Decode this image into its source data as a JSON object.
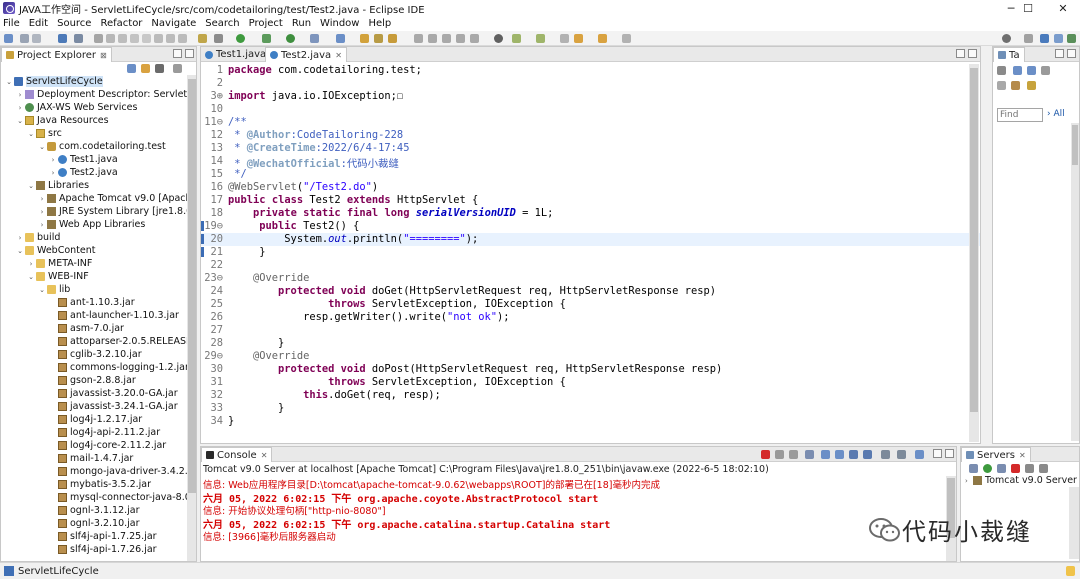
{
  "window": {
    "title": "JAVA工作空间 - ServletLifeCycle/src/com/codetailoring/test/Test2.java - Eclipse IDE",
    "min_glyph": "─",
    "max_glyph": "☐",
    "close_glyph": "✕"
  },
  "menu": [
    "File",
    "Edit",
    "Source",
    "Refactor",
    "Navigate",
    "Search",
    "Project",
    "Run",
    "Window",
    "Help"
  ],
  "project_explorer": {
    "tab_label": "Project Explorer",
    "close_glyph": "⊠",
    "tree": [
      {
        "label": "ServletLifeCycle",
        "icon": "project",
        "depth": 0,
        "arrow": "⌄"
      },
      {
        "label": "Deployment Descriptor: ServletLifec",
        "icon": "desc",
        "depth": 1,
        "arrow": "›"
      },
      {
        "label": "JAX-WS Web Services",
        "icon": "ws",
        "depth": 1,
        "arrow": "›"
      },
      {
        "label": "Java Resources",
        "icon": "srcfolder",
        "depth": 1,
        "arrow": "⌄"
      },
      {
        "label": "src",
        "icon": "srcfolder",
        "depth": 2,
        "arrow": "⌄"
      },
      {
        "label": "com.codetailoring.test",
        "icon": "pkg",
        "depth": 3,
        "arrow": "⌄"
      },
      {
        "label": "Test1.java",
        "icon": "java",
        "depth": 4,
        "arrow": "›"
      },
      {
        "label": "Test2.java",
        "icon": "java",
        "depth": 4,
        "arrow": "›"
      },
      {
        "label": "Libraries",
        "icon": "lib",
        "depth": 2,
        "arrow": "⌄"
      },
      {
        "label": "Apache Tomcat v9.0 [Apache T",
        "icon": "lib",
        "depth": 3,
        "arrow": "›"
      },
      {
        "label": "JRE System Library [jre1.8.0_25",
        "icon": "lib",
        "depth": 3,
        "arrow": "›"
      },
      {
        "label": "Web App Libraries",
        "icon": "lib",
        "depth": 3,
        "arrow": "›"
      },
      {
        "label": "build",
        "icon": "folder",
        "depth": 1,
        "arrow": "›"
      },
      {
        "label": "WebContent",
        "icon": "folder",
        "depth": 1,
        "arrow": "⌄"
      },
      {
        "label": "META-INF",
        "icon": "folder",
        "depth": 2,
        "arrow": "›"
      },
      {
        "label": "WEB-INF",
        "icon": "folder",
        "depth": 2,
        "arrow": "⌄"
      },
      {
        "label": "lib",
        "icon": "folder",
        "depth": 3,
        "arrow": "⌄"
      },
      {
        "label": "ant-1.10.3.jar",
        "icon": "jar",
        "depth": 4,
        "arrow": ""
      },
      {
        "label": "ant-launcher-1.10.3.jar",
        "icon": "jar",
        "depth": 4,
        "arrow": ""
      },
      {
        "label": "asm-7.0.jar",
        "icon": "jar",
        "depth": 4,
        "arrow": ""
      },
      {
        "label": "attoparser-2.0.5.RELEASE.ja",
        "icon": "jar",
        "depth": 4,
        "arrow": ""
      },
      {
        "label": "cglib-3.2.10.jar",
        "icon": "jar",
        "depth": 4,
        "arrow": ""
      },
      {
        "label": "commons-logging-1.2.jar",
        "icon": "jar",
        "depth": 4,
        "arrow": ""
      },
      {
        "label": "gson-2.8.8.jar",
        "icon": "jar",
        "depth": 4,
        "arrow": ""
      },
      {
        "label": "javassist-3.20.0-GA.jar",
        "icon": "jar",
        "depth": 4,
        "arrow": ""
      },
      {
        "label": "javassist-3.24.1-GA.jar",
        "icon": "jar",
        "depth": 4,
        "arrow": ""
      },
      {
        "label": "log4j-1.2.17.jar",
        "icon": "jar",
        "depth": 4,
        "arrow": ""
      },
      {
        "label": "log4j-api-2.11.2.jar",
        "icon": "jar",
        "depth": 4,
        "arrow": ""
      },
      {
        "label": "log4j-core-2.11.2.jar",
        "icon": "jar",
        "depth": 4,
        "arrow": ""
      },
      {
        "label": "mail-1.4.7.jar",
        "icon": "jar",
        "depth": 4,
        "arrow": ""
      },
      {
        "label": "mongo-java-driver-3.4.2.jar",
        "icon": "jar",
        "depth": 4,
        "arrow": ""
      },
      {
        "label": "mybatis-3.5.2.jar",
        "icon": "jar",
        "depth": 4,
        "arrow": ""
      },
      {
        "label": "mysql-connector-java-8.0.1",
        "icon": "jar",
        "depth": 4,
        "arrow": ""
      },
      {
        "label": "ognl-3.1.12.jar",
        "icon": "jar",
        "depth": 4,
        "arrow": ""
      },
      {
        "label": "ognl-3.2.10.jar",
        "icon": "jar",
        "depth": 4,
        "arrow": ""
      },
      {
        "label": "slf4j-api-1.7.25.jar",
        "icon": "jar",
        "depth": 4,
        "arrow": ""
      },
      {
        "label": "slf4j-api-1.7.26.jar",
        "icon": "jar",
        "depth": 4,
        "arrow": ""
      }
    ]
  },
  "editor": {
    "tabs": [
      {
        "label": "Test1.java",
        "active": false
      },
      {
        "label": "Test2.java",
        "active": true
      }
    ],
    "close_glyph": "✕",
    "lines": [
      {
        "n": "1",
        "html": "<span class=\"kw\">package</span> com.codetailoring.test;"
      },
      {
        "n": "2",
        "html": ""
      },
      {
        "n": "3⊕",
        "html": "<span class=\"kw\">import</span> java.io.IOException;☐"
      },
      {
        "n": "10",
        "html": ""
      },
      {
        "n": "11⊖",
        "html": "<span class=\"cm\">/**</span>"
      },
      {
        "n": "12",
        "html": "<span class=\"cm\"> * </span><span class=\"tag\">@Author</span><span class=\"cm\">:CodeTailoring-228</span>"
      },
      {
        "n": "13",
        "html": "<span class=\"cm\"> * </span><span class=\"tag\">@CreateTime</span><span class=\"cm\">:2022/6/4-17:45</span>"
      },
      {
        "n": "14",
        "html": "<span class=\"cm\"> * </span><span class=\"tag\">@WechatOfficial</span><span class=\"cm\">:代码小裁缝</span>"
      },
      {
        "n": "15",
        "html": "<span class=\"cm\"> */</span>"
      },
      {
        "n": "16",
        "html": "<span class=\"ann\">@WebServlet</span>(<span class=\"str\">\"/Test2.do\"</span>)"
      },
      {
        "n": "17",
        "html": "<span class=\"kw\">public</span> <span class=\"kw\">class</span> Test2 <span class=\"kw\">extends</span> HttpServlet {"
      },
      {
        "n": "18",
        "html": "    <span class=\"kw\">private</span> <span class=\"kw\">static</span> <span class=\"kw\">final</span> <span class=\"kw\">long</span> <span class=\"fld\">serialVersionUID</span> = 1L;"
      },
      {
        "n": "19⊖",
        "html": "     <span class=\"kw\">public</span> Test2() {"
      },
      {
        "n": "20",
        "html": "         System.<span class=\"sfld\">out</span>.println(<span class=\"str\">\"========\"</span>);",
        "highlight": true
      },
      {
        "n": "21",
        "html": "     }"
      },
      {
        "n": "22",
        "html": ""
      },
      {
        "n": "23⊖",
        "html": "    <span class=\"ann\">@Override</span>"
      },
      {
        "n": "24",
        "html": "        <span class=\"kw\">protected</span> <span class=\"kw\">void</span> doGet(HttpServletRequest req, HttpServletResponse resp)"
      },
      {
        "n": "25",
        "html": "                <span class=\"kw\">throws</span> ServletException, IOException {"
      },
      {
        "n": "26",
        "html": "            resp.getWriter().write(<span class=\"str\">\"not ok\"</span>);"
      },
      {
        "n": "27",
        "html": ""
      },
      {
        "n": "28",
        "html": "        }"
      },
      {
        "n": "29⊖",
        "html": "    <span class=\"ann\">@Override</span>"
      },
      {
        "n": "30",
        "html": "        <span class=\"kw\">protected</span> <span class=\"kw\">void</span> doPost(HttpServletRequest req, HttpServletResponse resp)"
      },
      {
        "n": "31",
        "html": "                <span class=\"kw\">throws</span> ServletException, IOException {"
      },
      {
        "n": "32",
        "html": "            <span class=\"kw\">this</span>.doGet(req, resp);"
      },
      {
        "n": "33",
        "html": "        }"
      },
      {
        "n": "34",
        "html": "}"
      }
    ]
  },
  "task_pane": {
    "tab_label": "Ta",
    "find_placeholder": "Find",
    "all_label": "All"
  },
  "console": {
    "tab_label": "Console",
    "header": "Tomcat v9.0 Server at localhost [Apache Tomcat] C:\\Program Files\\Java\\jre1.8.0_251\\bin\\javaw.exe  (2022-6-5 18:02:10)",
    "lines": [
      {
        "text": "信息: Web应用程序目录[D:\\tomcat\\apache-tomcat-9.0.62\\webapps\\ROOT]的部署已在[18]毫秒内完成",
        "mono": false
      },
      {
        "text": "六月 05, 2022 6:02:15 下午 org.apache.coyote.AbstractProtocol start",
        "mono": true
      },
      {
        "text": "信息: 开始协议处理句柄[\"http-nio-8080\"]",
        "mono": false
      },
      {
        "text": "六月 05, 2022 6:02:15 下午 org.apache.catalina.startup.Catalina start",
        "mono": true
      },
      {
        "text": "信息: [3966]毫秒后服务器启动",
        "mono": false
      }
    ]
  },
  "servers": {
    "tab_label": "Servers",
    "item": "Tomcat v9.0 Server at"
  },
  "status": {
    "text": "ServletLifeCycle"
  },
  "watermark": {
    "text": "代码小裁缝"
  },
  "colors": {
    "keyword": "#7f0055",
    "comment": "#3f5fbf",
    "string": "#2a00ff",
    "console_error": "#d40000",
    "selection": "#cfe3f7"
  }
}
